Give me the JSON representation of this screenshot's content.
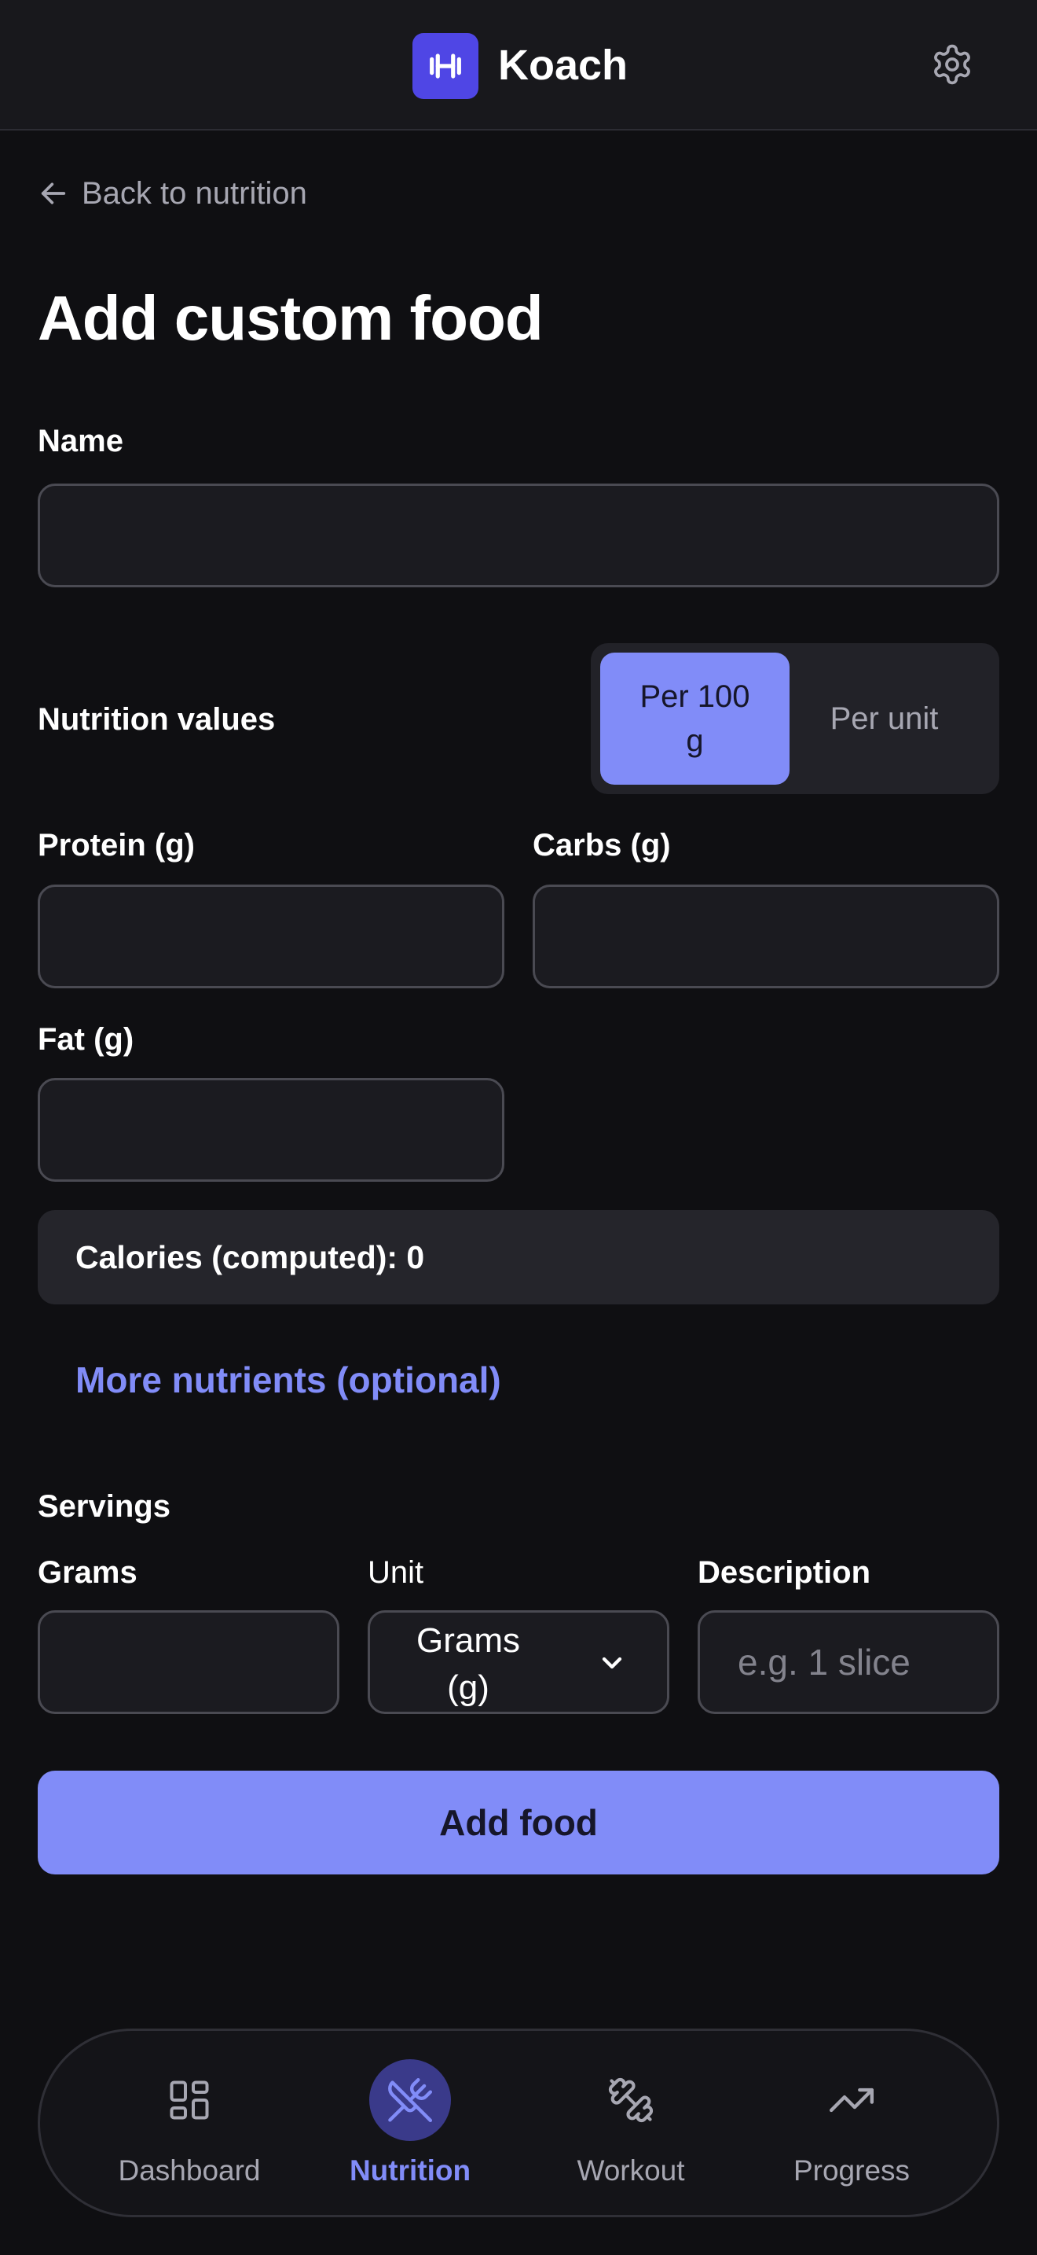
{
  "header": {
    "brand": "Koach",
    "logo_icon": "dumbbell-icon",
    "settings_icon": "gear-icon",
    "accent": "#4f46e5"
  },
  "back_link": {
    "label": "Back to nutrition",
    "icon": "arrow-left-icon"
  },
  "page_title": "Add custom food",
  "name_field": {
    "label": "Name",
    "value": "",
    "placeholder": ""
  },
  "nutrition": {
    "label": "Nutrition values",
    "toggle": {
      "options": [
        "Per 100 g",
        "Per unit"
      ],
      "selected": "Per 100 g"
    },
    "protein": {
      "label": "Protein (g)",
      "value": ""
    },
    "carbs": {
      "label": "Carbs (g)",
      "value": ""
    },
    "fat": {
      "label": "Fat (g)",
      "value": ""
    },
    "calories": "Calories (computed): 0",
    "more_nutrients": "More nutrients (optional)"
  },
  "servings": {
    "label": "Servings",
    "grams": {
      "label": "Grams",
      "value": ""
    },
    "unit": {
      "label": "Unit",
      "selected": "Grams (g)"
    },
    "description": {
      "label": "Description",
      "placeholder": "e.g. 1 slice",
      "value": ""
    }
  },
  "submit_label": "Add food",
  "bottom_nav": {
    "items": [
      {
        "label": "Dashboard",
        "icon": "dashboard-grid-icon",
        "active": false
      },
      {
        "label": "Nutrition",
        "icon": "utensils-icon",
        "active": true
      },
      {
        "label": "Workout",
        "icon": "dumbbell-icon",
        "active": false
      },
      {
        "label": "Progress",
        "icon": "trending-up-icon",
        "active": false
      }
    ]
  },
  "colors": {
    "background": "#0f0f12",
    "surface": "#18181c",
    "accent_light": "#818cf8",
    "muted_text": "#a7a7b2"
  }
}
